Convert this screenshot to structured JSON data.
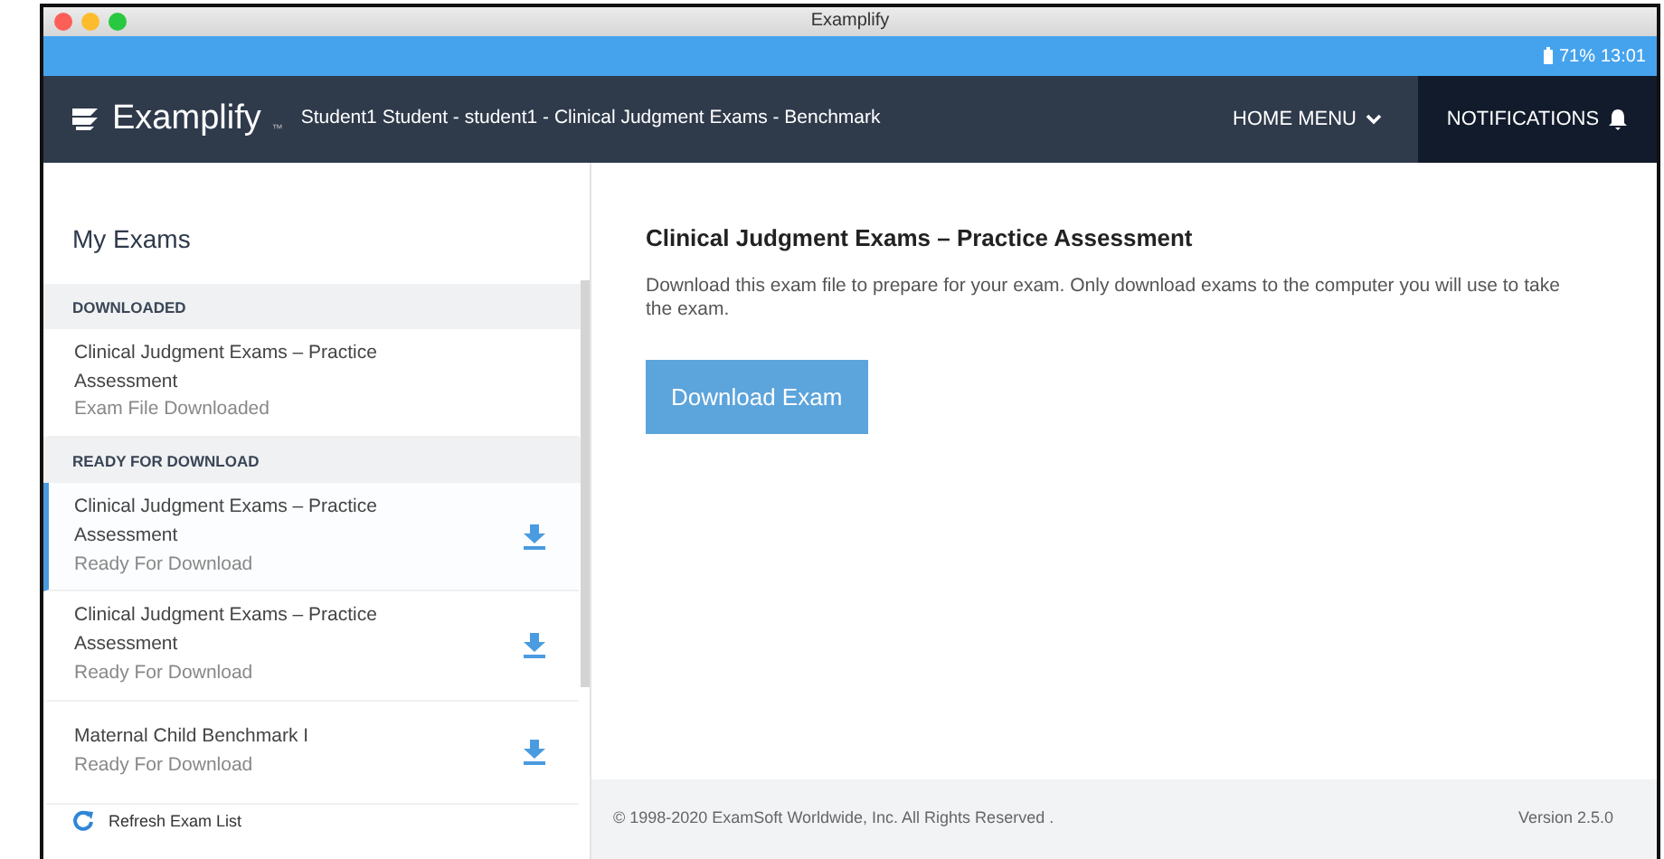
{
  "window": {
    "title": "Examplify"
  },
  "status_bar": {
    "battery": "71%",
    "time": "13:01"
  },
  "navbar": {
    "brand": "Examplify",
    "trademark": "™",
    "context": "Student1 Student - student1 - Clinical Judgment Exams - Benchmark",
    "menu": "HOME MENU",
    "notifications": "NOTIFICATIONS"
  },
  "sidebar": {
    "title": "My Exams",
    "sections": [
      {
        "heading": "DOWNLOADED",
        "items": [
          {
            "title": "Clinical Judgment Exams – Practice Assessment",
            "status": "Exam File Downloaded",
            "selected": false,
            "downloadable": false
          }
        ]
      },
      {
        "heading": "READY FOR DOWNLOAD",
        "items": [
          {
            "title": "Clinical Judgment Exams – Practice Assessment",
            "status": "Ready For Download",
            "selected": true,
            "downloadable": true
          },
          {
            "title": "Clinical Judgment Exams – Practice Assessment",
            "status": "Ready For Download",
            "selected": false,
            "downloadable": true
          },
          {
            "title": "Maternal Child Benchmark I",
            "status": "Ready For Download",
            "selected": false,
            "downloadable": true
          }
        ]
      }
    ],
    "refresh": "Refresh Exam List"
  },
  "detail": {
    "title": "Clinical Judgment Exams – Practice Assessment",
    "description": "Download this exam file to prepare for your exam. Only download exams to the computer you will use to take the exam.",
    "button": "Download Exam"
  },
  "footer": {
    "copyright": "© 1998-2020 ExamSoft Worldwide, Inc. All Rights Reserved .",
    "version": "Version 2.5.0"
  }
}
